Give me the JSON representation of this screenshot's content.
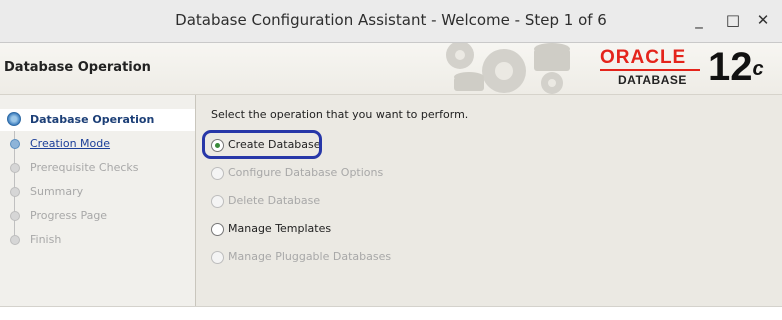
{
  "window": {
    "title": "Database Configuration Assistant - Welcome - Step 1 of 6",
    "minimize_label": "_",
    "maximize_label": "□",
    "close_label": "✕"
  },
  "header": {
    "title": "Database Operation",
    "logo": {
      "brand": "ORACLE",
      "product": "DATABASE",
      "version": "12",
      "version_suffix": "c"
    }
  },
  "steps": [
    {
      "label": "Database Operation",
      "state": "current"
    },
    {
      "label": "Creation Mode",
      "state": "link"
    },
    {
      "label": "Prerequisite Checks",
      "state": "disabled"
    },
    {
      "label": "Summary",
      "state": "disabled"
    },
    {
      "label": "Progress Page",
      "state": "disabled"
    },
    {
      "label": "Finish",
      "state": "disabled"
    }
  ],
  "main": {
    "prompt": "Select the operation that you want to perform.",
    "options": [
      {
        "label": "Create Database",
        "selected": true,
        "enabled": true
      },
      {
        "label": "Configure Database Options",
        "selected": false,
        "enabled": false
      },
      {
        "label": "Delete Database",
        "selected": false,
        "enabled": false
      },
      {
        "label": "Manage Templates",
        "selected": false,
        "enabled": true
      },
      {
        "label": "Manage Pluggable Databases",
        "selected": false,
        "enabled": false
      }
    ]
  },
  "colors": {
    "oracle_red": "#e4241b",
    "highlight_outline": "#2737a8",
    "radio_selected": "#3a8a3a"
  }
}
